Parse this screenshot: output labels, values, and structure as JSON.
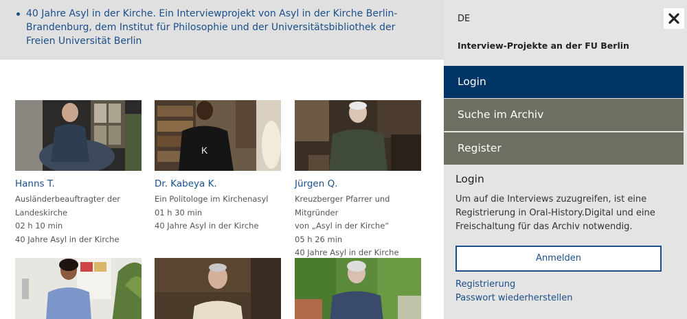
{
  "banner": {
    "text": "40 Jahre Asyl in der Kirche. Ein Interviewprojekt von Asyl in der Kirche Berlin-Brandenburg, dem Institut für Philosophie und der Universitätsbibliothek der Freien Universität Berlin"
  },
  "cards": [
    {
      "name": "Hanns T.",
      "lines": [
        "Ausländerbeauftragter der",
        "Landeskirche",
        "02 h 10 min",
        "40 Jahre Asyl in der Kirche"
      ]
    },
    {
      "name": "Dr. Kabeya K.",
      "lines": [
        "Ein Politologe im Kirchenasyl",
        "01 h 30 min",
        "40 Jahre Asyl in der Kirche"
      ]
    },
    {
      "name": "Jürgen Q.",
      "lines": [
        "Kreuzberger Pfarrer und Mitgründer",
        "von „Asyl in der Kirche“",
        "05 h 26 min",
        "40 Jahre Asyl in der Kirche"
      ]
    }
  ],
  "sidebar": {
    "lang": "DE",
    "site_title": "Interview-Projekte an der FU Berlin",
    "nav": {
      "login": "Login",
      "search": "Suche im Archiv",
      "register": "Register"
    },
    "login_heading": "Login",
    "login_text": "Um auf die Interviews zuzugreifen, ist eine Registrierung in Oral-History.Digital und eine Freischaltung für das Archiv notwendig.",
    "login_button": "Anmelden",
    "link_register": "Registrierung",
    "link_password": "Passwort wiederherstellen"
  },
  "colors": {
    "accent": "#1a4f8a",
    "nav_active": "#003366",
    "nav_default": "#6e6e62",
    "sidebar_bg": "#e4e4e4",
    "banner_bg": "#e0e0e0"
  }
}
